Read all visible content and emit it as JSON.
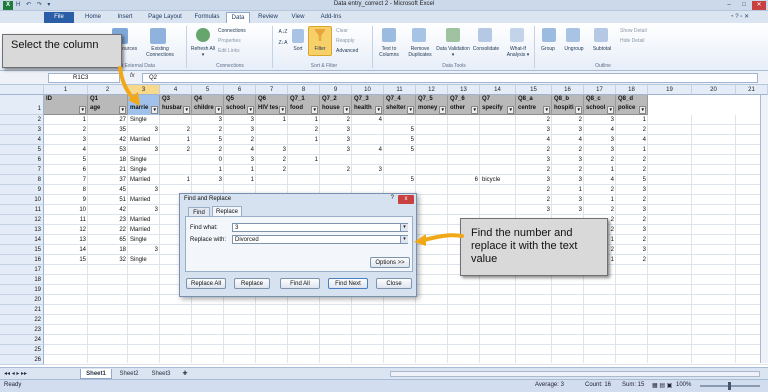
{
  "window": {
    "title": "Data entry_correct 2 - Microsoft Excel",
    "quick_access": "H ↶ ↷ ▾"
  },
  "ribbon_tabs": [
    "File",
    "Home",
    "Insert",
    "Page Layout",
    "Formulas",
    "Data",
    "Review",
    "View",
    "Add-Ins"
  ],
  "active_tab": "Data",
  "ribbon": {
    "get_external": "Other Sources",
    "existing_connections": "Existing Connections",
    "refresh_all": "Refresh All ▾",
    "connections": "Connections",
    "properties": "Properties",
    "edit_links": "Edit Links",
    "group_connections": "Connections",
    "sort_az": "A↓Z",
    "sort_za": "Z↓A",
    "sort": "Sort",
    "filter": "Filter",
    "clear": "Clear",
    "reapply": "Reapply",
    "advanced": "Advanced",
    "group_sort_filter": "Sort & Filter",
    "text_to_columns": "Text to Columns",
    "remove_duplicates": "Remove Duplicates",
    "data_validation": "Data Validation ▾",
    "consolidate": "Consolidate",
    "what_if": "What-If Analysis ▾",
    "group_data_tools": "Data Tools",
    "group": "Group",
    "ungroup": "Ungroup",
    "subtotal": "Subtotal",
    "show_detail": "Show Detail",
    "hide_detail": "Hide Detail",
    "group_outline": "Outline",
    "get_external_group": "Get External Data"
  },
  "formula_bar": {
    "name_box": "R1C3",
    "fx": "fx",
    "value": "Q2"
  },
  "columns": [
    "1",
    "2",
    "3",
    "4",
    "5",
    "6",
    "7",
    "8",
    "9",
    "10",
    "11",
    "12",
    "13",
    "14",
    "15",
    "16",
    "17",
    "18",
    "19",
    "20",
    "21"
  ],
  "header_row_top": [
    "",
    "Q1",
    "Q2",
    "Q3",
    "Q4",
    "Q5",
    "Q6",
    "Q7_1",
    "Q7_2",
    "Q7_3",
    "Q7_4",
    "Q7_5",
    "Q7_6",
    "Q7",
    "Q8_a",
    "Q8_b",
    "Q8_c",
    "Q8_d",
    "",
    "",
    ""
  ],
  "header_row_bottom": [
    "ID",
    "age",
    "marrie",
    "husbar",
    "childre",
    "school",
    "HIV tes",
    "food",
    "house",
    "health",
    "shelter",
    "money",
    "other",
    "specify",
    "centre",
    "hospiti",
    "school",
    "police",
    "",
    "",
    ""
  ],
  "rows": [
    [
      "1",
      "27",
      "Single",
      "",
      "3",
      "3",
      "1",
      "1",
      "2",
      "4",
      "",
      "",
      "",
      "",
      "2",
      "2",
      "3",
      "1"
    ],
    [
      "2",
      "35",
      "3",
      "2",
      "2",
      "3",
      "",
      "2",
      "3",
      "",
      "5",
      "",
      "",
      "",
      "3",
      "3",
      "4",
      "2"
    ],
    [
      "3",
      "42",
      "Married",
      "1",
      "5",
      "2",
      "",
      "1",
      "3",
      "",
      "5",
      "",
      "",
      "",
      "4",
      "4",
      "3",
      "4"
    ],
    [
      "4",
      "53",
      "3",
      "2",
      "2",
      "4",
      "3",
      "",
      "3",
      "4",
      "5",
      "",
      "",
      "",
      "2",
      "2",
      "3",
      "1"
    ],
    [
      "5",
      "18",
      "Single",
      "",
      "0",
      "3",
      "2",
      "1",
      "",
      "",
      "",
      "",
      "",
      "",
      "3",
      "3",
      "2",
      "2"
    ],
    [
      "6",
      "21",
      "Single",
      "",
      "1",
      "1",
      "2",
      "",
      "2",
      "3",
      "",
      "",
      "",
      "",
      "2",
      "2",
      "1",
      "2"
    ],
    [
      "7",
      "37",
      "Married",
      "1",
      "3",
      "1",
      "",
      "",
      "",
      "",
      "5",
      "",
      "6",
      "bicycle",
      "3",
      "3",
      "4",
      "5"
    ],
    [
      "8",
      "45",
      "3",
      "",
      "",
      "",
      "",
      "",
      "",
      "",
      "",
      "",
      "",
      "",
      "2",
      "1",
      "2",
      "3"
    ],
    [
      "9",
      "51",
      "Married",
      "",
      "",
      "",
      "",
      "",
      "",
      "",
      "5",
      "",
      "",
      "",
      "2",
      "3",
      "1",
      "2"
    ],
    [
      "10",
      "42",
      "3",
      "",
      "",
      "",
      "",
      "",
      "",
      "",
      "",
      "",
      "",
      "",
      "3",
      "3",
      "2",
      "3"
    ],
    [
      "11",
      "23",
      "Married",
      "",
      "",
      "",
      "",
      "",
      "",
      "",
      "",
      "",
      "",
      "",
      "",
      "",
      "2",
      "2"
    ],
    [
      "12",
      "22",
      "Married",
      "",
      "",
      "",
      "",
      "",
      "",
      "",
      "",
      "",
      "",
      "",
      "",
      "",
      "2",
      "3"
    ],
    [
      "13",
      "65",
      "Single",
      "",
      "",
      "",
      "",
      "",
      "",
      "",
      "",
      "",
      "",
      "",
      "",
      "",
      "1",
      "2"
    ],
    [
      "14",
      "18",
      "3",
      "",
      "",
      "",
      "",
      "",
      "",
      "",
      "",
      "",
      "",
      "",
      "",
      "",
      "2",
      "3"
    ],
    [
      "15",
      "32",
      "Single",
      "",
      "",
      "",
      "",
      "",
      "",
      "",
      "",
      "",
      "",
      "",
      "",
      "",
      "1",
      "2"
    ]
  ],
  "row_numbers": [
    "1",
    "2",
    "3",
    "4",
    "5",
    "6",
    "7",
    "8",
    "9",
    "10",
    "11",
    "12",
    "13",
    "14",
    "15",
    "16",
    "17",
    "18",
    "19",
    "20",
    "21",
    "22",
    "23",
    "24",
    "25",
    "26"
  ],
  "callouts": {
    "left": "Select the column",
    "right": "Find the number and replace it with the text value"
  },
  "dialog": {
    "title": "Find and Replace",
    "help": "?",
    "close": "x",
    "tab_find": "Find",
    "tab_replace": "Replace",
    "find_label": "Find what:",
    "find_value": "3",
    "replace_label": "Replace with:",
    "replace_value": "Divorced",
    "options_button": "Options >>",
    "replace_all": "Replace All",
    "replace": "Replace",
    "find_all": "Find All",
    "find_next": "Find Next",
    "close_button": "Close"
  },
  "sheets": [
    "Sheet1",
    "Sheet2",
    "Sheet3"
  ],
  "active_sheet": "Sheet1",
  "status": {
    "ready": "Ready",
    "average": "Average: 3",
    "count": "Count: 16",
    "sum": "Sum: 15",
    "zoom": "100%"
  },
  "colors": {
    "excel_green": "#1e7b3c",
    "file_tab": "#2a5fa8",
    "selected_column": "#c8dcf6",
    "header_gray": "#b9b9b9",
    "arrow_orange": "#f0a818"
  }
}
